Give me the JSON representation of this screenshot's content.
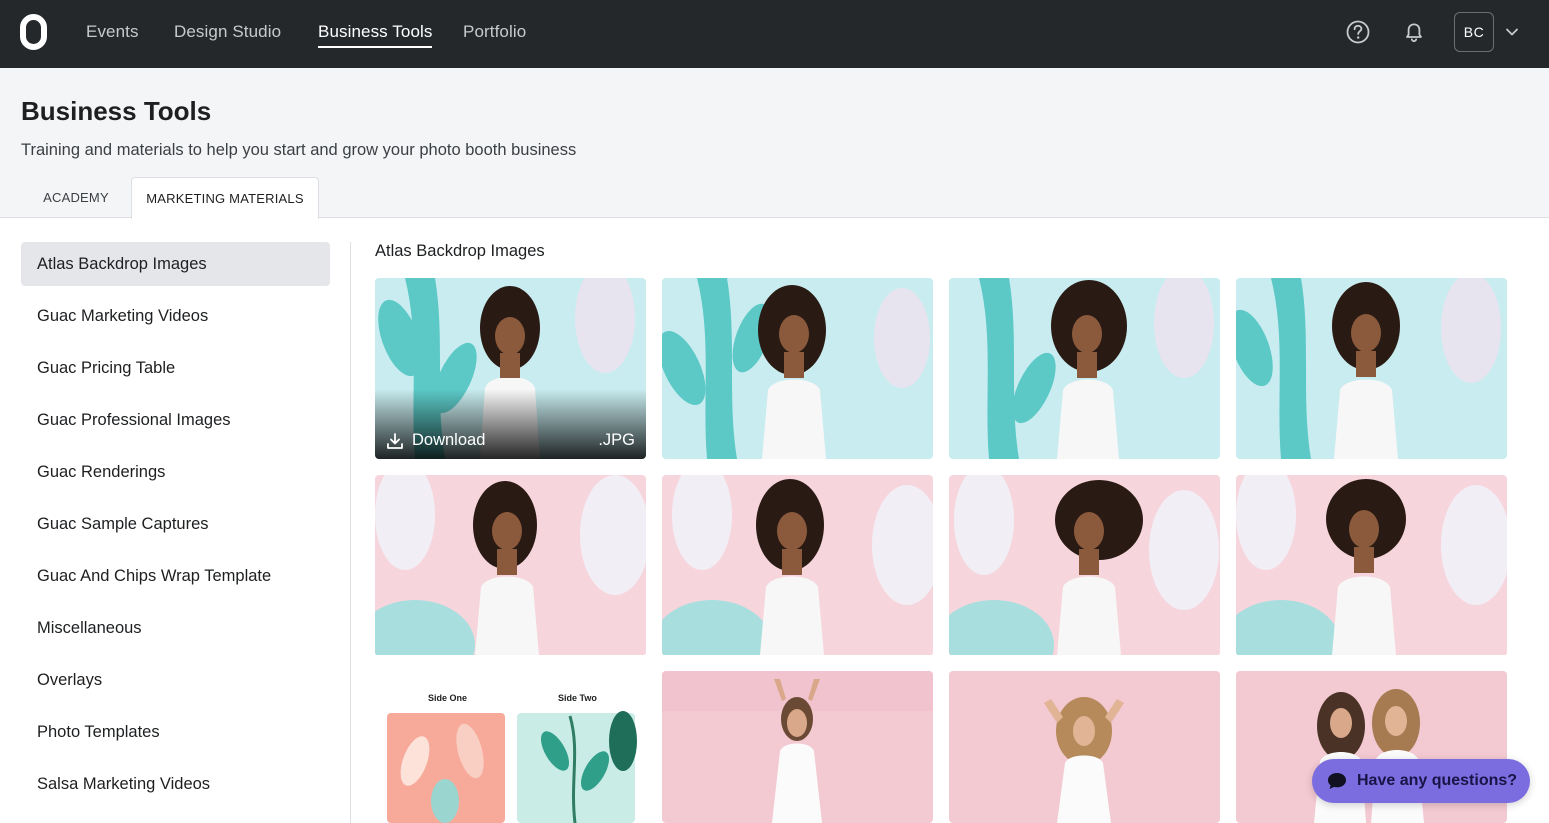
{
  "nav": {
    "items": [
      {
        "label": "Events"
      },
      {
        "label": "Design Studio"
      },
      {
        "label": "Business Tools"
      },
      {
        "label": "Portfolio"
      }
    ],
    "active": "Business Tools",
    "avatar_initials": "BC",
    "icons": [
      "logo-icon",
      "help-icon",
      "bell-icon",
      "chevron-down-icon"
    ]
  },
  "header": {
    "title": "Business Tools",
    "subtitle": "Training and materials to help you start and grow your photo booth business",
    "tabs": [
      {
        "label": "ACADEMY"
      },
      {
        "label": "MARKETING MATERIALS"
      }
    ],
    "active_tab": "MARKETING MATERIALS"
  },
  "sidebar": {
    "items": [
      {
        "label": "Atlas Backdrop Images"
      },
      {
        "label": "Guac Marketing Videos"
      },
      {
        "label": "Guac Pricing Table"
      },
      {
        "label": "Guac Professional Images"
      },
      {
        "label": "Guac Renderings"
      },
      {
        "label": "Guac Sample Captures"
      },
      {
        "label": "Guac And Chips Wrap Template"
      },
      {
        "label": "Miscellaneous"
      },
      {
        "label": "Overlays"
      },
      {
        "label": "Photo Templates"
      },
      {
        "label": "Salsa Marketing Videos"
      }
    ],
    "active": "Atlas Backdrop Images"
  },
  "gallery": {
    "title": "Atlas Backdrop Images",
    "hover": {
      "download_label": "Download",
      "file_type": ".JPG"
    },
    "template_labels": {
      "side_one": "Side One",
      "side_two": "Side Two"
    }
  },
  "chat": {
    "label": "Have any questions?"
  },
  "colors": {
    "topbar": "#25282b",
    "teal_backdrop": "#bfe8ec",
    "pink_backdrop": "#f6d6dc",
    "chat_button": "#7b6de0"
  }
}
